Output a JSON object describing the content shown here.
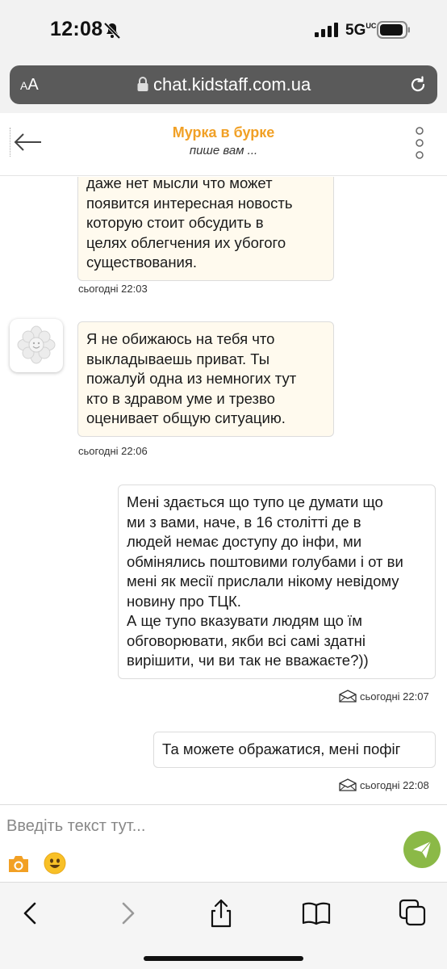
{
  "status_bar": {
    "time": "12:08",
    "network": "5G",
    "network_sup": "UC",
    "icons": [
      "bell-slash-icon",
      "signal-icon",
      "battery-icon"
    ]
  },
  "browser": {
    "aa_label_small": "A",
    "aa_label": "A",
    "url": "chat.kidstaff.com.ua"
  },
  "chat": {
    "contact_name": "Мурка в бурке",
    "status": "пише вам ..."
  },
  "messages": [
    {
      "direction": "in",
      "text": "даже нет мысли что может\nпоявится интересная новость\nкоторую стоит обсудить в\nцелях облегчения их убогого\nсуществования.",
      "timestamp": "сьогодні 22:03"
    },
    {
      "direction": "in",
      "text": "Я не обижаюсь на тебя что\nвыкладываешь приват. Ты\nпожалуй одна из немногих тут\nкто в здравом уме и трезво\nоценивает общую ситуацию.",
      "timestamp": "сьогодні 22:06"
    },
    {
      "direction": "out",
      "text": "Мені здається що тупо це думати що\nми з вами, наче, в 16 столітті де в\nлюдей немає доступу до інфи, ми\nобмінялись поштовими голубами і от ви\nмені як месії прислали нікому невідому\nновину про ТЦК.\nА ще тупо вказувати людям що їм\nобговорювати, якби всі самі здатні\nвирішити, чи ви так не вважаєте?))",
      "timestamp": "сьогодні 22:07"
    },
    {
      "direction": "out",
      "text": "Та можете ображатися, мені пофіг",
      "timestamp": "сьогодні 22:08"
    }
  ],
  "composer": {
    "placeholder": "Введіть текст тут..."
  },
  "colors": {
    "accent_orange": "#f1a025",
    "send_green": "#8bb947",
    "incoming_bubble": "#fffaee"
  }
}
